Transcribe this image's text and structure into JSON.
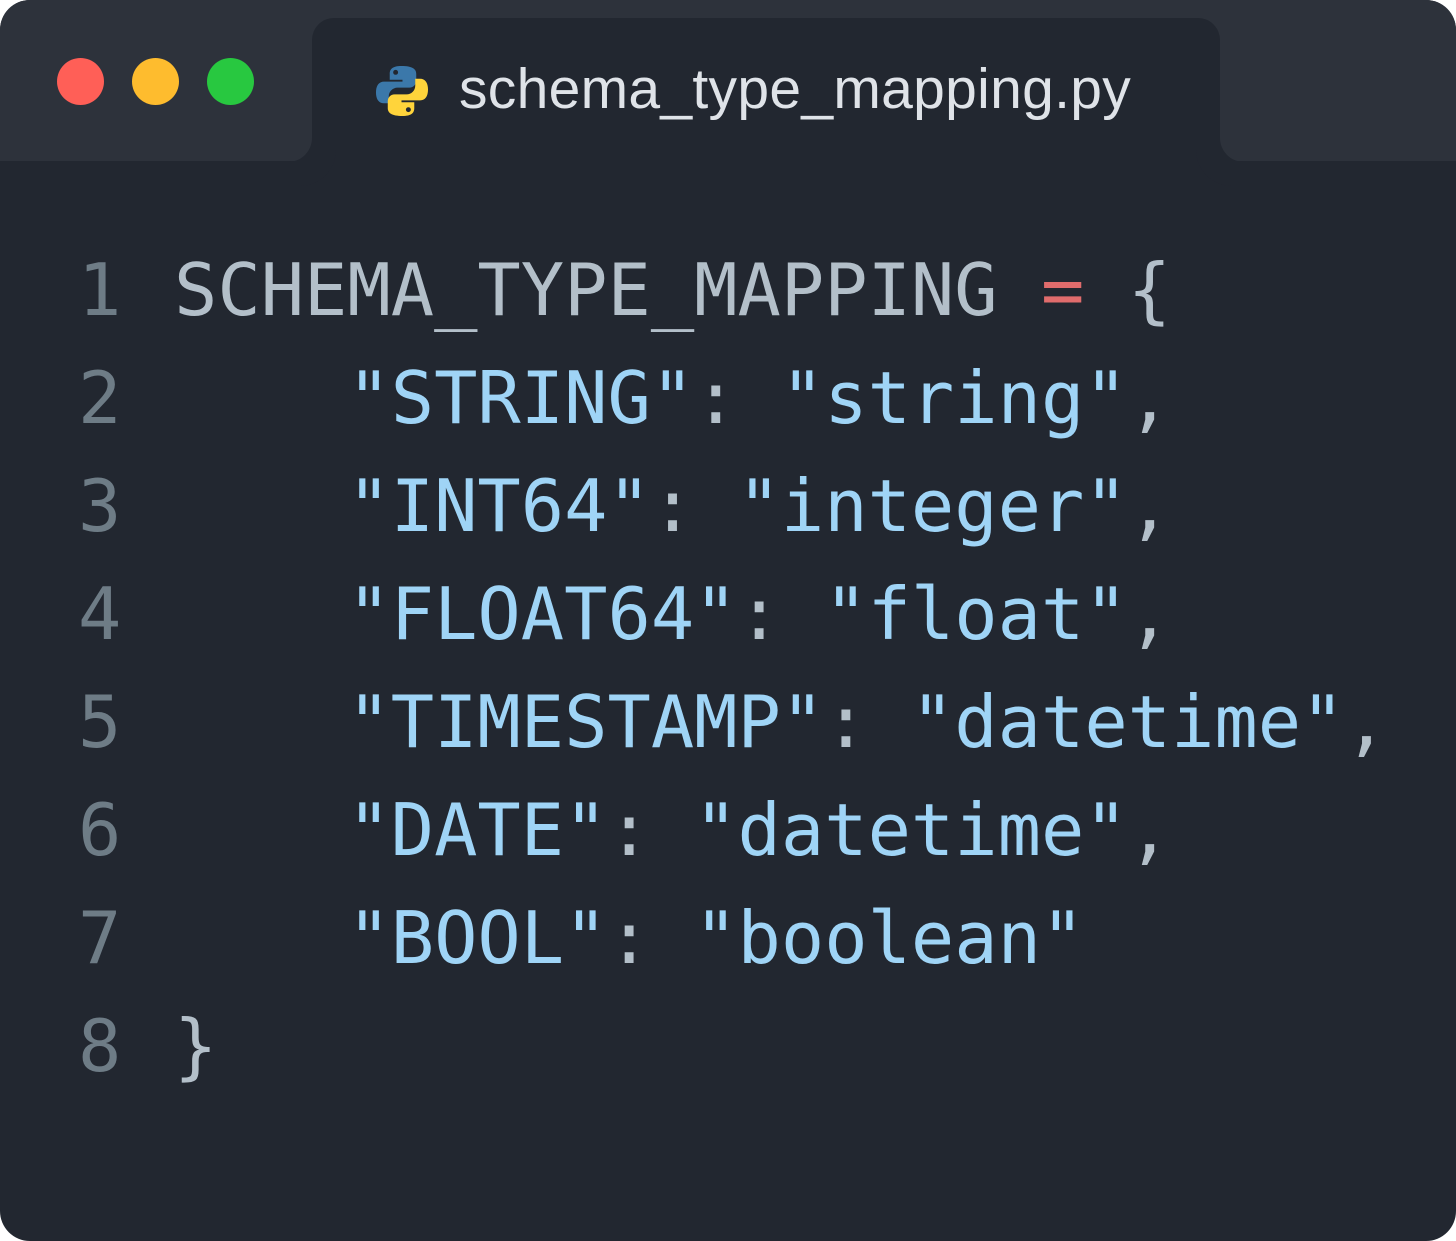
{
  "window": {
    "traffic_lights": [
      {
        "name": "close",
        "color": "#ff5f57"
      },
      {
        "name": "minimize",
        "color": "#febc2e"
      },
      {
        "name": "maximize",
        "color": "#28c840"
      }
    ],
    "tab": {
      "icon": "python-icon",
      "title": "schema_type_mapping.py"
    }
  },
  "colors": {
    "identifier": "#b3bfc9",
    "operator": "#e06c6c",
    "punctuation": "#b3bfc9",
    "string": "#9fd4f6",
    "line_number": "#6e7c86",
    "background": "#222730",
    "titlebar": "#2d323b"
  },
  "code": {
    "lines": [
      {
        "number": "1",
        "tokens": [
          {
            "text": "SCHEMA_TYPE_MAPPING",
            "kind": "identifier"
          },
          {
            "text": " ",
            "kind": "space"
          },
          {
            "text": "=",
            "kind": "operator"
          },
          {
            "text": " ",
            "kind": "space"
          },
          {
            "text": "{",
            "kind": "punctuation"
          }
        ]
      },
      {
        "number": "2",
        "tokens": [
          {
            "text": "    ",
            "kind": "space"
          },
          {
            "text": "\"STRING\"",
            "kind": "string"
          },
          {
            "text": ": ",
            "kind": "punctuation"
          },
          {
            "text": "\"string\"",
            "kind": "string"
          },
          {
            "text": ",",
            "kind": "punctuation"
          }
        ]
      },
      {
        "number": "3",
        "tokens": [
          {
            "text": "    ",
            "kind": "space"
          },
          {
            "text": "\"INT64\"",
            "kind": "string"
          },
          {
            "text": ": ",
            "kind": "punctuation"
          },
          {
            "text": "\"integer\"",
            "kind": "string"
          },
          {
            "text": ",",
            "kind": "punctuation"
          }
        ]
      },
      {
        "number": "4",
        "tokens": [
          {
            "text": "    ",
            "kind": "space"
          },
          {
            "text": "\"FLOAT64\"",
            "kind": "string"
          },
          {
            "text": ": ",
            "kind": "punctuation"
          },
          {
            "text": "\"float\"",
            "kind": "string"
          },
          {
            "text": ",",
            "kind": "punctuation"
          }
        ]
      },
      {
        "number": "5",
        "tokens": [
          {
            "text": "    ",
            "kind": "space"
          },
          {
            "text": "\"TIMESTAMP\"",
            "kind": "string"
          },
          {
            "text": ": ",
            "kind": "punctuation"
          },
          {
            "text": "\"datetime\"",
            "kind": "string"
          },
          {
            "text": ",",
            "kind": "punctuation"
          }
        ]
      },
      {
        "number": "6",
        "tokens": [
          {
            "text": "    ",
            "kind": "space"
          },
          {
            "text": "\"DATE\"",
            "kind": "string"
          },
          {
            "text": ": ",
            "kind": "punctuation"
          },
          {
            "text": "\"datetime\"",
            "kind": "string"
          },
          {
            "text": ",",
            "kind": "punctuation"
          }
        ]
      },
      {
        "number": "7",
        "tokens": [
          {
            "text": "    ",
            "kind": "space"
          },
          {
            "text": "\"BOOL\"",
            "kind": "string"
          },
          {
            "text": ": ",
            "kind": "punctuation"
          },
          {
            "text": "\"boolean\"",
            "kind": "string"
          }
        ]
      },
      {
        "number": "8",
        "tokens": [
          {
            "text": "}",
            "kind": "punctuation"
          }
        ]
      }
    ]
  }
}
